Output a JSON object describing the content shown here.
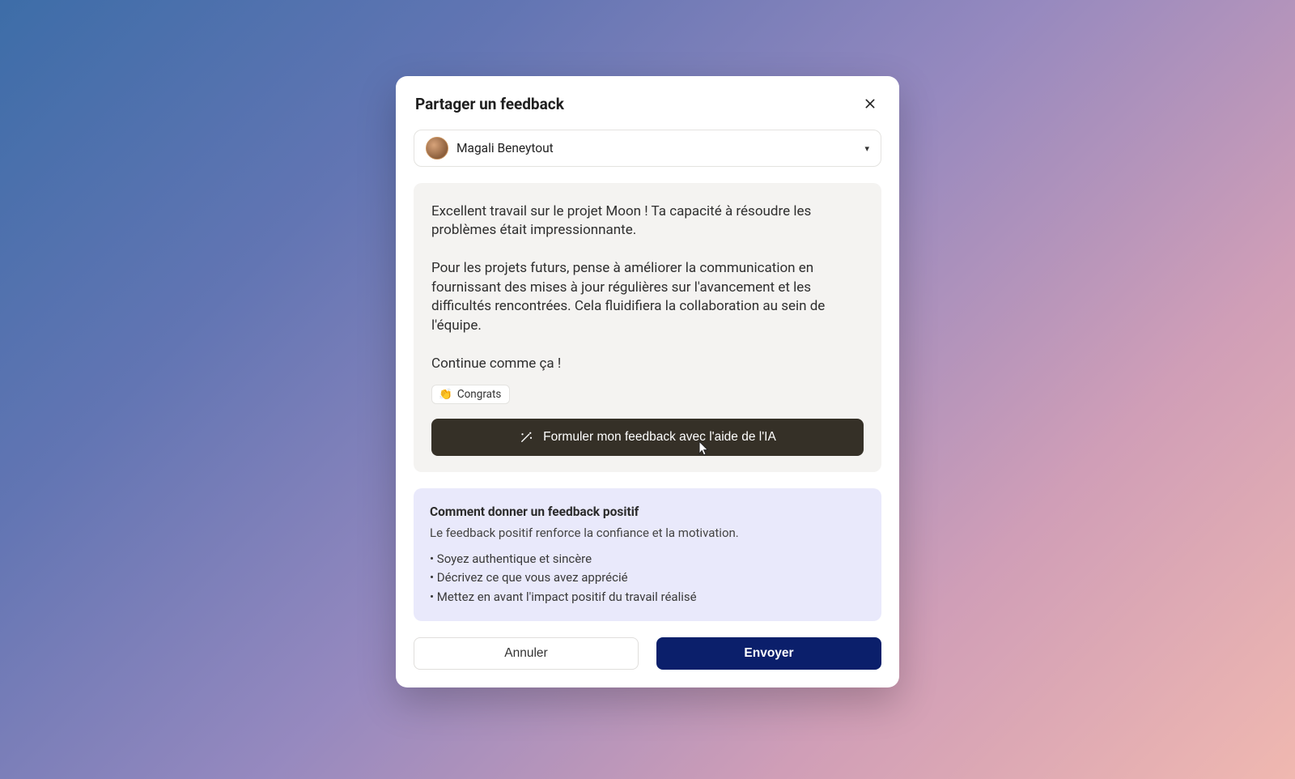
{
  "modal": {
    "title": "Partager un feedback",
    "recipient": {
      "name": "Magali Beneytout"
    },
    "feedback": {
      "paragraph1": "Excellent travail sur le projet Moon ! Ta capacité à résoudre les problèmes était impressionnante.",
      "paragraph2": "Pour les projets futurs, pense à améliorer la communication en fournissant des mises à jour régulières sur l'avancement et les difficultés rencontrées. Cela fluidifiera la collaboration au sein de l'équipe.",
      "paragraph3": "Continue comme ça !"
    },
    "tag": {
      "emoji": "👏",
      "label": "Congrats"
    },
    "ai_button": "Formuler mon feedback avec l'aide de l'IA",
    "tips": {
      "title": "Comment donner un feedback positif",
      "subtitle": "Le feedback positif renforce la confiance et la motivation.",
      "items": [
        "Soyez authentique et sincère",
        "Décrivez ce que vous avez apprécié",
        "Mettez en avant l'impact positif du travail réalisé"
      ]
    },
    "actions": {
      "cancel": "Annuler",
      "submit": "Envoyer"
    }
  }
}
